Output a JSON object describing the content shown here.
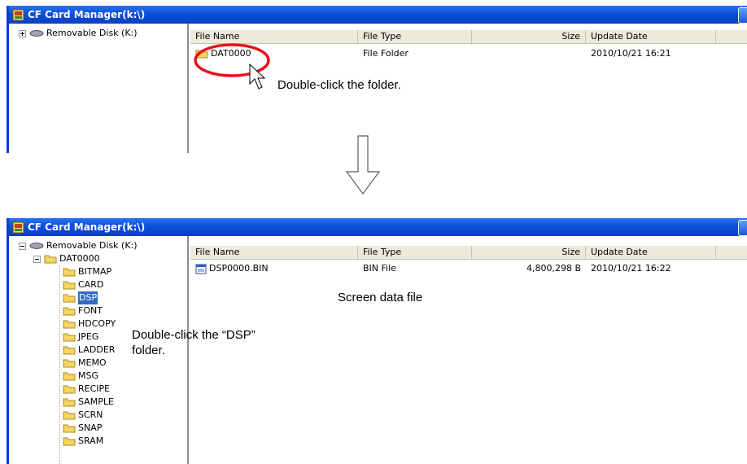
{
  "top_window": {
    "title": "CF Card Manager(k:\\)",
    "tree": {
      "root_label": "Removable Disk (K:)"
    },
    "columns": [
      "File Name",
      "File Type",
      "Size",
      "Update Date"
    ],
    "rows": [
      {
        "name": "DAT0000",
        "type": "File Folder",
        "size": "",
        "date": "2010/10/21 16:21"
      }
    ],
    "callout": "Double-click the folder."
  },
  "arrow": {
    "icon": "down-arrow-icon"
  },
  "bottom_window": {
    "title": "CF Card Manager(k:\\)",
    "tree": {
      "root_label": "Removable Disk (K:)",
      "parent_label": "DAT0000",
      "children": [
        "BITMAP",
        "CARD",
        "DSP",
        "FONT",
        "HDCOPY",
        "JPEG",
        "LADDER",
        "MEMO",
        "MSG",
        "RECIPE",
        "SAMPLE",
        "SCRN",
        "SNAP",
        "SRAM"
      ],
      "selected": "DSP"
    },
    "columns": [
      "File Name",
      "File Type",
      "Size",
      "Update Date"
    ],
    "rows": [
      {
        "name": "DSP0000.BIN",
        "type": "BIN File",
        "size": "4,800,298 B",
        "date": "2010/10/21 16:22"
      }
    ],
    "callout_file": "Screen data file",
    "callout_folder_line1": "Double-click the “DSP”",
    "callout_folder_line2": "folder."
  },
  "colors": {
    "titlebar": "#0b4fdc",
    "selection": "#316ac5",
    "highlight_ring": "#e8101a"
  }
}
